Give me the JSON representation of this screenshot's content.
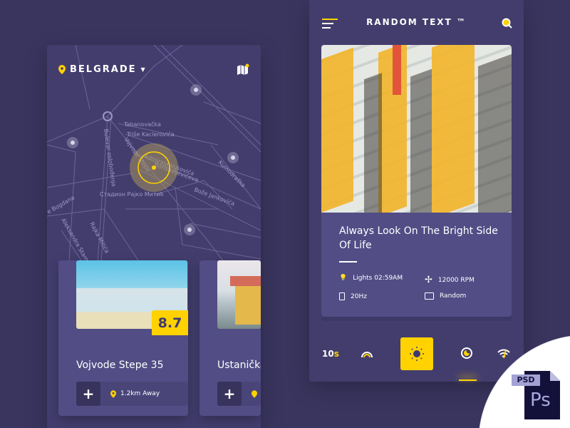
{
  "map_screen": {
    "location": "BELGRADE",
    "map_labels": [
      "Tabanovačka",
      "Triše Kaclerovića",
      "Admirala Vukovića",
      "Borisavljevićeva",
      "Vojvode Stepe",
      "Стадион Рајко Митић",
      "Bulevar oslobođenja",
      "Kumodraška",
      "Bože Jankovića",
      "Aleksandra Stamb.",
      "Rajka Mitića",
      "e Bogdana"
    ],
    "cards": [
      {
        "title": "Vojvode Stepe 35",
        "score": "8.7",
        "distance": "1.2km Away"
      },
      {
        "title": "Ustanička",
        "distance": ""
      }
    ]
  },
  "detail_screen": {
    "title": "RANDOM TEXT ™",
    "headline": "Always Look On The Bright Side Of Life",
    "stats": [
      {
        "icon": "lightbulb-icon",
        "label": "Lights 02:59AM"
      },
      {
        "icon": "fan-icon",
        "label": "12000 RPM"
      },
      {
        "icon": "speaker-icon",
        "label": "20Hz"
      },
      {
        "icon": "display-icon",
        "label": "Random"
      }
    ],
    "timer": {
      "value": "10",
      "unit": "s"
    }
  },
  "badge": {
    "text": "PSD",
    "logo": "Ps"
  },
  "colors": {
    "accent": "#ffd200",
    "background": "#3a355f",
    "panel": "#433d6e",
    "card": "#524d85"
  }
}
